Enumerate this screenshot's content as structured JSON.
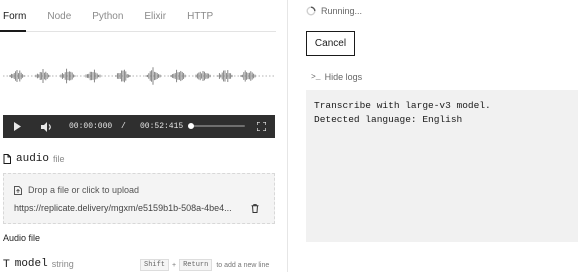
{
  "tabs": [
    {
      "label": "Form",
      "active": true
    },
    {
      "label": "Node",
      "active": false
    },
    {
      "label": "Python",
      "active": false
    },
    {
      "label": "Elixir",
      "active": false
    },
    {
      "label": "HTTP",
      "active": false
    }
  ],
  "player": {
    "current_time": "00:00:000",
    "separator": "/",
    "duration": "00:52:415",
    "progress": 0.0,
    "icons": {
      "play": "play-icon",
      "volume": "volume-icon",
      "fullscreen": "fullscreen-icon"
    }
  },
  "audio_input": {
    "name": "audio",
    "type": "file",
    "drop_text": "Drop a file or click to upload",
    "url": "https://replicate.delivery/mgxm/e5159b1b-508a-4be4...",
    "description": "Audio file"
  },
  "model_input": {
    "name": "model",
    "type": "string",
    "key1": "Shift",
    "plus": "+",
    "key2": "Return",
    "hint_rest": "to add a new line"
  },
  "run": {
    "status": "Running...",
    "cancel_label": "Cancel",
    "hide_logs_label": "Hide logs",
    "logs": "Transcribe with large-v3 model.\nDetected language: English"
  }
}
